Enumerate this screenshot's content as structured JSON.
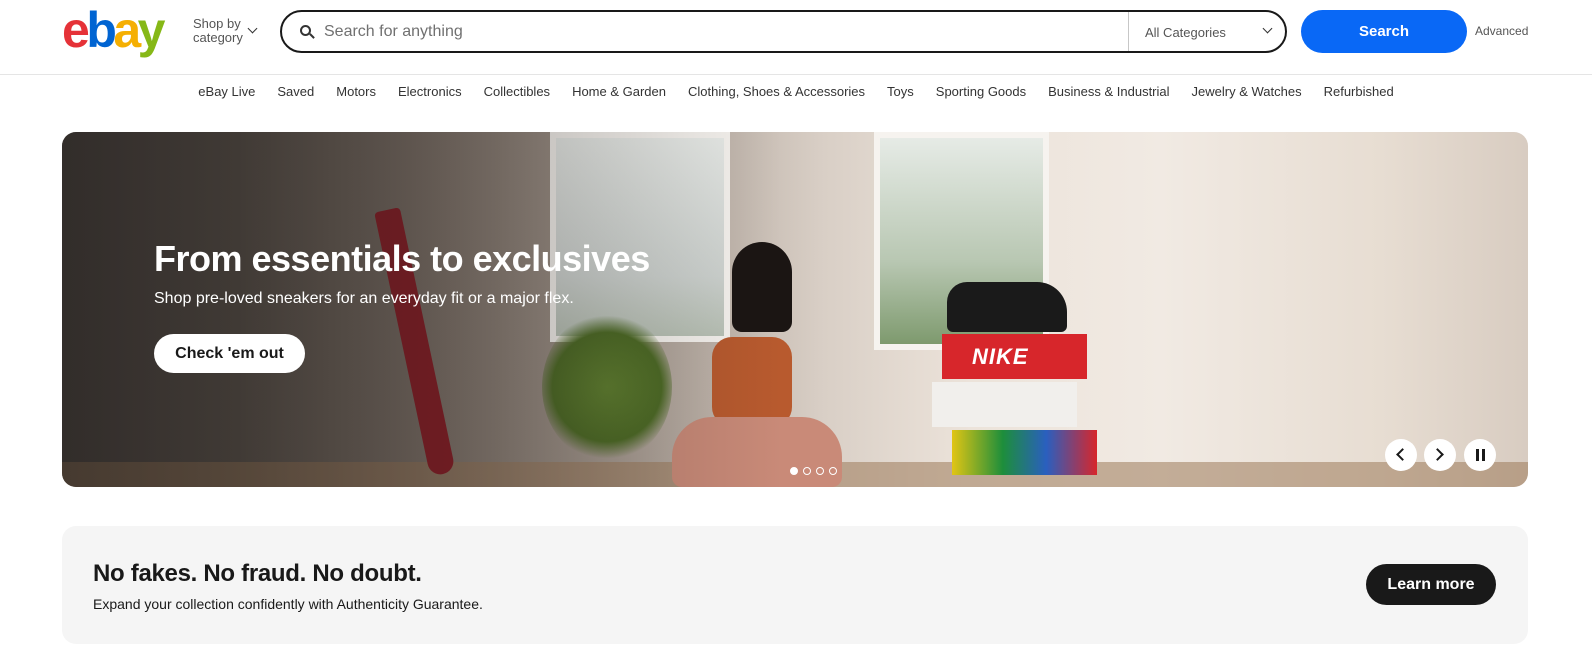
{
  "header": {
    "logo_letters": [
      "e",
      "b",
      "a",
      "y"
    ],
    "shop_by_line1": "Shop by",
    "shop_by_line2": "category",
    "search_placeholder": "Search for anything",
    "category_select": "All Categories",
    "search_button": "Search",
    "advanced_link": "Advanced"
  },
  "category_nav": [
    "eBay Live",
    "Saved",
    "Motors",
    "Electronics",
    "Collectibles",
    "Home & Garden",
    "Clothing, Shoes & Accessories",
    "Toys",
    "Sporting Goods",
    "Business & Industrial",
    "Jewelry & Watches",
    "Refurbished"
  ],
  "hero": {
    "title": "From essentials to exclusives",
    "subtitle": "Shop pre-loved sneakers for an everyday fit or a major flex.",
    "cta": "Check 'em out",
    "box_brand": "NIKE",
    "slide_count": 4,
    "active_slide": 1
  },
  "authenticity": {
    "title": "No fakes. No fraud. No doubt.",
    "subtitle": "Expand your collection confidently with Authenticity Guarantee.",
    "cta": "Learn more"
  },
  "colors": {
    "logo_e": "#e53238",
    "logo_b": "#0064d2",
    "logo_a": "#f5af02",
    "logo_y": "#86b817",
    "primary_blue": "#0968f6",
    "dark": "#191919"
  },
  "icons": {
    "search": "search-icon",
    "chevron": "chevron-down-icon",
    "prev": "chevron-left-icon",
    "next": "chevron-right-icon",
    "pause": "pause-icon"
  }
}
